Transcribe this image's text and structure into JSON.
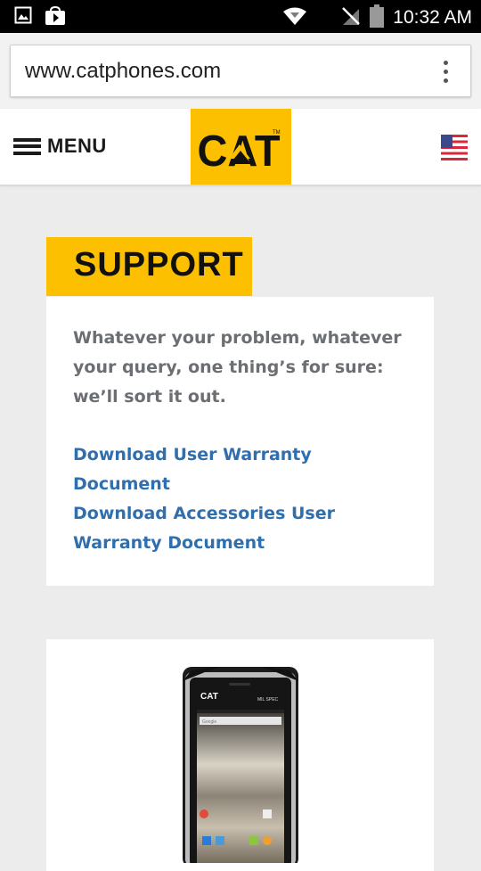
{
  "status_bar": {
    "time": "10:32 AM",
    "left_icons": [
      "image-notification-icon",
      "play-store-icon"
    ],
    "right_icons": [
      "wifi-icon",
      "no-signal-icon",
      "battery-icon"
    ]
  },
  "browser": {
    "url": "www.catphones.com",
    "menu_icon": "overflow-menu-icon"
  },
  "header": {
    "menu_label": "MENU",
    "logo_text": "CAT",
    "region_icon": "us-flag-icon"
  },
  "support": {
    "title": "SUPPORT",
    "intro": "Whatever your problem, whatever your query, one thing’s for sure: we’ll sort it out.",
    "links": [
      "Download User Warranty Document",
      "Download Accessories User Warranty Document"
    ]
  },
  "product": {
    "phone_brand": "CAT",
    "phone_label": "MIL SPEC",
    "search_label": "Google"
  },
  "colors": {
    "brand_yellow": "#fcc000",
    "link_blue": "#2f6fae",
    "body_gray": "#6b6e72",
    "page_bg": "#ececec"
  }
}
